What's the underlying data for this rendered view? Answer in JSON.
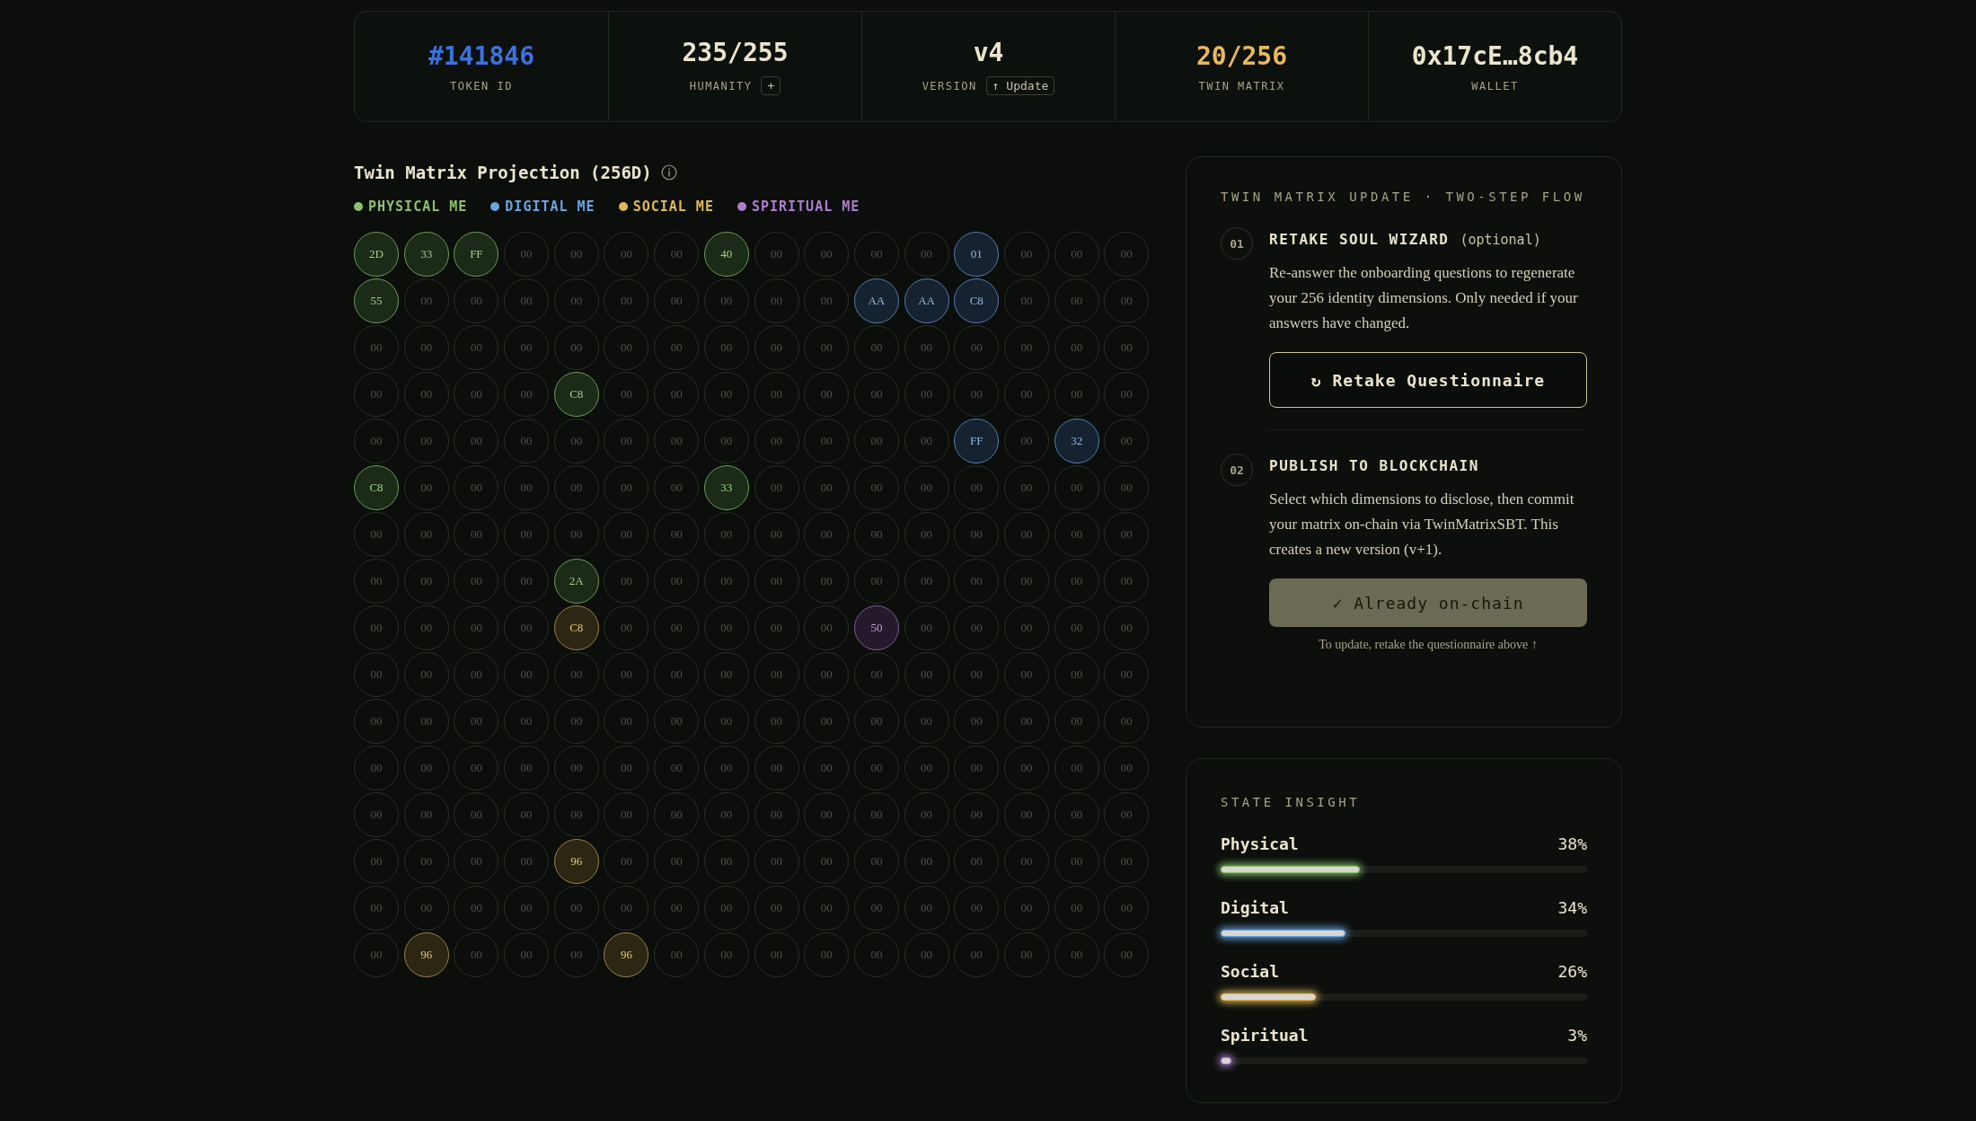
{
  "stats": [
    {
      "value": "#141846",
      "label": "TOKEN ID",
      "color": "#3a72de"
    },
    {
      "value": "235/255",
      "label": "HUMANITY",
      "color": "#ece4cc",
      "action": "+"
    },
    {
      "value": "v4",
      "label": "VERSION",
      "color": "#ece4cc",
      "action": "↑ Update"
    },
    {
      "value": "20/256",
      "label": "TWIN MATRIX",
      "color": "#e8b860"
    },
    {
      "value": "0x17cE…8cb4",
      "label": "WALLET",
      "color": "#ece4cc"
    }
  ],
  "matrix": {
    "title": "Twin Matrix Projection (256D)",
    "legend": [
      {
        "label": "PHYSICAL ME",
        "color": "#8cc070"
      },
      {
        "label": "DIGITAL ME",
        "color": "#6aa4e0"
      },
      {
        "label": "SOCIAL ME",
        "color": "#e0b858"
      },
      {
        "label": "SPIRITUAL ME",
        "color": "#b07cd0"
      }
    ],
    "rows": [
      [
        {
          "value": "2D",
          "kind": "physical"
        },
        {
          "value": "33",
          "kind": "physical"
        },
        {
          "value": "FF",
          "kind": "physical"
        },
        {
          "value": "00",
          "kind": "empty"
        },
        {
          "value": "00",
          "kind": "empty"
        },
        {
          "value": "00",
          "kind": "empty"
        },
        {
          "value": "00",
          "kind": "empty"
        },
        {
          "value": "40",
          "kind": "physical"
        },
        {
          "value": "00",
          "kind": "empty"
        },
        {
          "value": "00",
          "kind": "empty"
        },
        {
          "value": "00",
          "kind": "empty"
        },
        {
          "value": "00",
          "kind": "empty"
        },
        {
          "value": "01",
          "kind": "digital"
        },
        {
          "value": "00",
          "kind": "empty"
        },
        {
          "value": "00",
          "kind": "empty"
        },
        {
          "value": "00",
          "kind": "empty"
        }
      ],
      [
        {
          "value": "55",
          "kind": "physical"
        },
        {
          "value": "00",
          "kind": "empty"
        },
        {
          "value": "00",
          "kind": "empty"
        },
        {
          "value": "00",
          "kind": "empty"
        },
        {
          "value": "00",
          "kind": "empty"
        },
        {
          "value": "00",
          "kind": "empty"
        },
        {
          "value": "00",
          "kind": "empty"
        },
        {
          "value": "00",
          "kind": "empty"
        },
        {
          "value": "00",
          "kind": "empty"
        },
        {
          "value": "00",
          "kind": "empty"
        },
        {
          "value": "AA",
          "kind": "digital"
        },
        {
          "value": "AA",
          "kind": "digital"
        },
        {
          "value": "C8",
          "kind": "digital"
        },
        {
          "value": "00",
          "kind": "empty"
        },
        {
          "value": "00",
          "kind": "empty"
        },
        {
          "value": "00",
          "kind": "empty"
        }
      ],
      [
        {
          "value": "00",
          "kind": "empty"
        },
        {
          "value": "00",
          "kind": "empty"
        },
        {
          "value": "00",
          "kind": "empty"
        },
        {
          "value": "00",
          "kind": "empty"
        },
        {
          "value": "00",
          "kind": "empty"
        },
        {
          "value": "00",
          "kind": "empty"
        },
        {
          "value": "00",
          "kind": "empty"
        },
        {
          "value": "00",
          "kind": "empty"
        },
        {
          "value": "00",
          "kind": "empty"
        },
        {
          "value": "00",
          "kind": "empty"
        },
        {
          "value": "00",
          "kind": "empty"
        },
        {
          "value": "00",
          "kind": "empty"
        },
        {
          "value": "00",
          "kind": "empty"
        },
        {
          "value": "00",
          "kind": "empty"
        },
        {
          "value": "00",
          "kind": "empty"
        },
        {
          "value": "00",
          "kind": "empty"
        }
      ],
      [
        {
          "value": "00",
          "kind": "empty"
        },
        {
          "value": "00",
          "kind": "empty"
        },
        {
          "value": "00",
          "kind": "empty"
        },
        {
          "value": "00",
          "kind": "empty"
        },
        {
          "value": "C8",
          "kind": "physical"
        },
        {
          "value": "00",
          "kind": "empty"
        },
        {
          "value": "00",
          "kind": "empty"
        },
        {
          "value": "00",
          "kind": "empty"
        },
        {
          "value": "00",
          "kind": "empty"
        },
        {
          "value": "00",
          "kind": "empty"
        },
        {
          "value": "00",
          "kind": "empty"
        },
        {
          "value": "00",
          "kind": "empty"
        },
        {
          "value": "00",
          "kind": "empty"
        },
        {
          "value": "00",
          "kind": "empty"
        },
        {
          "value": "00",
          "kind": "empty"
        },
        {
          "value": "00",
          "kind": "empty"
        }
      ],
      [
        {
          "value": "00",
          "kind": "empty"
        },
        {
          "value": "00",
          "kind": "empty"
        },
        {
          "value": "00",
          "kind": "empty"
        },
        {
          "value": "00",
          "kind": "empty"
        },
        {
          "value": "00",
          "kind": "empty"
        },
        {
          "value": "00",
          "kind": "empty"
        },
        {
          "value": "00",
          "kind": "empty"
        },
        {
          "value": "00",
          "kind": "empty"
        },
        {
          "value": "00",
          "kind": "empty"
        },
        {
          "value": "00",
          "kind": "empty"
        },
        {
          "value": "00",
          "kind": "empty"
        },
        {
          "value": "00",
          "kind": "empty"
        },
        {
          "value": "FF",
          "kind": "digital"
        },
        {
          "value": "00",
          "kind": "empty"
        },
        {
          "value": "32",
          "kind": "digital"
        },
        {
          "value": "00",
          "kind": "empty"
        }
      ],
      [
        {
          "value": "C8",
          "kind": "physical"
        },
        {
          "value": "00",
          "kind": "empty"
        },
        {
          "value": "00",
          "kind": "empty"
        },
        {
          "value": "00",
          "kind": "empty"
        },
        {
          "value": "00",
          "kind": "empty"
        },
        {
          "value": "00",
          "kind": "empty"
        },
        {
          "value": "00",
          "kind": "empty"
        },
        {
          "value": "33",
          "kind": "physical"
        },
        {
          "value": "00",
          "kind": "empty"
        },
        {
          "value": "00",
          "kind": "empty"
        },
        {
          "value": "00",
          "kind": "empty"
        },
        {
          "value": "00",
          "kind": "empty"
        },
        {
          "value": "00",
          "kind": "empty"
        },
        {
          "value": "00",
          "kind": "empty"
        },
        {
          "value": "00",
          "kind": "empty"
        },
        {
          "value": "00",
          "kind": "empty"
        }
      ],
      [
        {
          "value": "00",
          "kind": "empty"
        },
        {
          "value": "00",
          "kind": "empty"
        },
        {
          "value": "00",
          "kind": "empty"
        },
        {
          "value": "00",
          "kind": "empty"
        },
        {
          "value": "00",
          "kind": "empty"
        },
        {
          "value": "00",
          "kind": "empty"
        },
        {
          "value": "00",
          "kind": "empty"
        },
        {
          "value": "00",
          "kind": "empty"
        },
        {
          "value": "00",
          "kind": "empty"
        },
        {
          "value": "00",
          "kind": "empty"
        },
        {
          "value": "00",
          "kind": "empty"
        },
        {
          "value": "00",
          "kind": "empty"
        },
        {
          "value": "00",
          "kind": "empty"
        },
        {
          "value": "00",
          "kind": "empty"
        },
        {
          "value": "00",
          "kind": "empty"
        },
        {
          "value": "00",
          "kind": "empty"
        }
      ],
      [
        {
          "value": "00",
          "kind": "empty"
        },
        {
          "value": "00",
          "kind": "empty"
        },
        {
          "value": "00",
          "kind": "empty"
        },
        {
          "value": "00",
          "kind": "empty"
        },
        {
          "value": "2A",
          "kind": "physical"
        },
        {
          "value": "00",
          "kind": "empty"
        },
        {
          "value": "00",
          "kind": "empty"
        },
        {
          "value": "00",
          "kind": "empty"
        },
        {
          "value": "00",
          "kind": "empty"
        },
        {
          "value": "00",
          "kind": "empty"
        },
        {
          "value": "00",
          "kind": "empty"
        },
        {
          "value": "00",
          "kind": "empty"
        },
        {
          "value": "00",
          "kind": "empty"
        },
        {
          "value": "00",
          "kind": "empty"
        },
        {
          "value": "00",
          "kind": "empty"
        },
        {
          "value": "00",
          "kind": "empty"
        }
      ],
      [
        {
          "value": "00",
          "kind": "empty"
        },
        {
          "value": "00",
          "kind": "empty"
        },
        {
          "value": "00",
          "kind": "empty"
        },
        {
          "value": "00",
          "kind": "empty"
        },
        {
          "value": "C8",
          "kind": "social"
        },
        {
          "value": "00",
          "kind": "empty"
        },
        {
          "value": "00",
          "kind": "empty"
        },
        {
          "value": "00",
          "kind": "empty"
        },
        {
          "value": "00",
          "kind": "empty"
        },
        {
          "value": "00",
          "kind": "empty"
        },
        {
          "value": "50",
          "kind": "spiritual"
        },
        {
          "value": "00",
          "kind": "empty"
        },
        {
          "value": "00",
          "kind": "empty"
        },
        {
          "value": "00",
          "kind": "empty"
        },
        {
          "value": "00",
          "kind": "empty"
        },
        {
          "value": "00",
          "kind": "empty"
        }
      ],
      [
        {
          "value": "00",
          "kind": "empty"
        },
        {
          "value": "00",
          "kind": "empty"
        },
        {
          "value": "00",
          "kind": "empty"
        },
        {
          "value": "00",
          "kind": "empty"
        },
        {
          "value": "00",
          "kind": "empty"
        },
        {
          "value": "00",
          "kind": "empty"
        },
        {
          "value": "00",
          "kind": "empty"
        },
        {
          "value": "00",
          "kind": "empty"
        },
        {
          "value": "00",
          "kind": "empty"
        },
        {
          "value": "00",
          "kind": "empty"
        },
        {
          "value": "00",
          "kind": "empty"
        },
        {
          "value": "00",
          "kind": "empty"
        },
        {
          "value": "00",
          "kind": "empty"
        },
        {
          "value": "00",
          "kind": "empty"
        },
        {
          "value": "00",
          "kind": "empty"
        },
        {
          "value": "00",
          "kind": "empty"
        }
      ],
      [
        {
          "value": "00",
          "kind": "empty"
        },
        {
          "value": "00",
          "kind": "empty"
        },
        {
          "value": "00",
          "kind": "empty"
        },
        {
          "value": "00",
          "kind": "empty"
        },
        {
          "value": "00",
          "kind": "empty"
        },
        {
          "value": "00",
          "kind": "empty"
        },
        {
          "value": "00",
          "kind": "empty"
        },
        {
          "value": "00",
          "kind": "empty"
        },
        {
          "value": "00",
          "kind": "empty"
        },
        {
          "value": "00",
          "kind": "empty"
        },
        {
          "value": "00",
          "kind": "empty"
        },
        {
          "value": "00",
          "kind": "empty"
        },
        {
          "value": "00",
          "kind": "empty"
        },
        {
          "value": "00",
          "kind": "empty"
        },
        {
          "value": "00",
          "kind": "empty"
        },
        {
          "value": "00",
          "kind": "empty"
        }
      ],
      [
        {
          "value": "00",
          "kind": "empty"
        },
        {
          "value": "00",
          "kind": "empty"
        },
        {
          "value": "00",
          "kind": "empty"
        },
        {
          "value": "00",
          "kind": "empty"
        },
        {
          "value": "00",
          "kind": "empty"
        },
        {
          "value": "00",
          "kind": "empty"
        },
        {
          "value": "00",
          "kind": "empty"
        },
        {
          "value": "00",
          "kind": "empty"
        },
        {
          "value": "00",
          "kind": "empty"
        },
        {
          "value": "00",
          "kind": "empty"
        },
        {
          "value": "00",
          "kind": "empty"
        },
        {
          "value": "00",
          "kind": "empty"
        },
        {
          "value": "00",
          "kind": "empty"
        },
        {
          "value": "00",
          "kind": "empty"
        },
        {
          "value": "00",
          "kind": "empty"
        },
        {
          "value": "00",
          "kind": "empty"
        }
      ],
      [
        {
          "value": "00",
          "kind": "empty"
        },
        {
          "value": "00",
          "kind": "empty"
        },
        {
          "value": "00",
          "kind": "empty"
        },
        {
          "value": "00",
          "kind": "empty"
        },
        {
          "value": "00",
          "kind": "empty"
        },
        {
          "value": "00",
          "kind": "empty"
        },
        {
          "value": "00",
          "kind": "empty"
        },
        {
          "value": "00",
          "kind": "empty"
        },
        {
          "value": "00",
          "kind": "empty"
        },
        {
          "value": "00",
          "kind": "empty"
        },
        {
          "value": "00",
          "kind": "empty"
        },
        {
          "value": "00",
          "kind": "empty"
        },
        {
          "value": "00",
          "kind": "empty"
        },
        {
          "value": "00",
          "kind": "empty"
        },
        {
          "value": "00",
          "kind": "empty"
        },
        {
          "value": "00",
          "kind": "empty"
        }
      ],
      [
        {
          "value": "00",
          "kind": "empty"
        },
        {
          "value": "00",
          "kind": "empty"
        },
        {
          "value": "00",
          "kind": "empty"
        },
        {
          "value": "00",
          "kind": "empty"
        },
        {
          "value": "96",
          "kind": "social"
        },
        {
          "value": "00",
          "kind": "empty"
        },
        {
          "value": "00",
          "kind": "empty"
        },
        {
          "value": "00",
          "kind": "empty"
        },
        {
          "value": "00",
          "kind": "empty"
        },
        {
          "value": "00",
          "kind": "empty"
        },
        {
          "value": "00",
          "kind": "empty"
        },
        {
          "value": "00",
          "kind": "empty"
        },
        {
          "value": "00",
          "kind": "empty"
        },
        {
          "value": "00",
          "kind": "empty"
        },
        {
          "value": "00",
          "kind": "empty"
        },
        {
          "value": "00",
          "kind": "empty"
        }
      ],
      [
        {
          "value": "00",
          "kind": "empty"
        },
        {
          "value": "00",
          "kind": "empty"
        },
        {
          "value": "00",
          "kind": "empty"
        },
        {
          "value": "00",
          "kind": "empty"
        },
        {
          "value": "00",
          "kind": "empty"
        },
        {
          "value": "00",
          "kind": "empty"
        },
        {
          "value": "00",
          "kind": "empty"
        },
        {
          "value": "00",
          "kind": "empty"
        },
        {
          "value": "00",
          "kind": "empty"
        },
        {
          "value": "00",
          "kind": "empty"
        },
        {
          "value": "00",
          "kind": "empty"
        },
        {
          "value": "00",
          "kind": "empty"
        },
        {
          "value": "00",
          "kind": "empty"
        },
        {
          "value": "00",
          "kind": "empty"
        },
        {
          "value": "00",
          "kind": "empty"
        },
        {
          "value": "00",
          "kind": "empty"
        }
      ],
      [
        {
          "value": "00",
          "kind": "empty"
        },
        {
          "value": "96",
          "kind": "social"
        },
        {
          "value": "00",
          "kind": "empty"
        },
        {
          "value": "00",
          "kind": "empty"
        },
        {
          "value": "00",
          "kind": "empty"
        },
        {
          "value": "96",
          "kind": "social"
        },
        {
          "value": "00",
          "kind": "empty"
        },
        {
          "value": "00",
          "kind": "empty"
        },
        {
          "value": "00",
          "kind": "empty"
        },
        {
          "value": "00",
          "kind": "empty"
        },
        {
          "value": "00",
          "kind": "empty"
        },
        {
          "value": "00",
          "kind": "empty"
        },
        {
          "value": "00",
          "kind": "empty"
        },
        {
          "value": "00",
          "kind": "empty"
        },
        {
          "value": "00",
          "kind": "empty"
        },
        {
          "value": "00",
          "kind": "empty"
        }
      ]
    ]
  },
  "update_flow": {
    "heading": "TWIN MATRIX UPDATE · TWO-STEP FLOW",
    "steps": [
      {
        "number": "01",
        "title": "RETAKE SOUL WIZARD",
        "suffix": "(optional)",
        "description": "Re-answer the onboarding questions to regenerate your 256 identity dimensions. Only needed if your answers have changed.",
        "button": "↻ Retake Questionnaire",
        "disabled": false
      },
      {
        "number": "02",
        "title": "PUBLISH TO BLOCKCHAIN",
        "description": "Select which dimensions to disclose, then commit your matrix on-chain via TwinMatrixSBT. This creates a new version (v+1).",
        "button": "✓ Already on-chain",
        "disabled": true,
        "note": "To update, retake the questionnaire above ↑"
      }
    ]
  },
  "insight": {
    "heading": "STATE INSIGHT",
    "bars": [
      {
        "label": "Physical",
        "reading": "38%",
        "level": 0.38,
        "color": "#8cc070"
      },
      {
        "label": "Digital",
        "reading": "34%",
        "level": 0.34,
        "color": "#6aa4e0"
      },
      {
        "label": "Social",
        "reading": "26%",
        "level": 0.26,
        "color": "#e0b858"
      },
      {
        "label": "Spiritual",
        "reading": "3%",
        "level": 0.03,
        "color": "#b07cd0"
      }
    ]
  }
}
